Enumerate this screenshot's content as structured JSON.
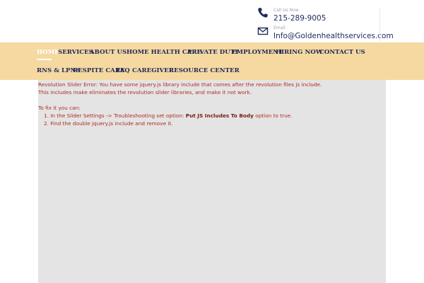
{
  "header": {
    "phone": {
      "label": "Call Us Now",
      "value": "215-289-9005"
    },
    "email": {
      "label": "Email",
      "value": "Info@Goldenhealthservices.com"
    }
  },
  "nav": {
    "items": [
      {
        "label": "HOME"
      },
      {
        "label": "SERVICES"
      },
      {
        "label": "ABOUT US"
      },
      {
        "label": "HOME HEALTH CARE"
      },
      {
        "label": "PRIVATE DUTY"
      },
      {
        "label": "EMPLOYMENT"
      },
      {
        "label": "HIRING NOW"
      },
      {
        "label": "CONTACT US"
      },
      {
        "label": "RNS & LPNS"
      },
      {
        "label": "RESPITE CARE"
      },
      {
        "label": "FAQ"
      },
      {
        "label": "CAREGIVER"
      },
      {
        "label": "RESOURCE CENTER"
      }
    ]
  },
  "error": {
    "line1": "Revolution Slider Error: You have some jquery.js library include that comes after the revolution files js include.",
    "line2": "This includes make eliminates the revolution slider libraries, and make it not work.",
    "fix_title": "To fix it you can:",
    "step1_prefix": "1. In the Slider Settings -> Troubleshooting set option: ",
    "step1_bold": "Put JS Includes To Body",
    "step1_suffix": " option to true.",
    "step2": "2. Find the double jquery.js include and remove it."
  },
  "colors": {
    "nav_bg": "#f5d9a1",
    "nav_text": "#1f2a5a",
    "error_text": "#b02a1f",
    "content_bg": "#e4e4e4"
  }
}
